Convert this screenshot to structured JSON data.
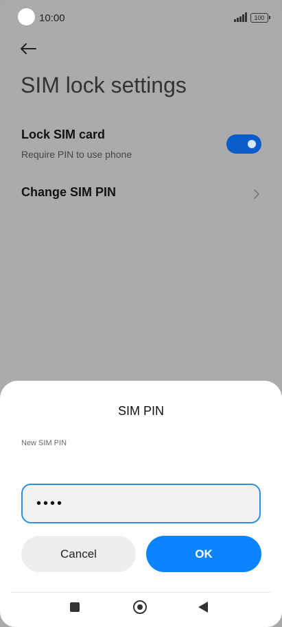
{
  "status_bar": {
    "time": "10:00",
    "battery": "100"
  },
  "page": {
    "title": "SIM lock settings"
  },
  "settings": {
    "lock_sim": {
      "title": "Lock SIM card",
      "subtitle": "Require PIN to use phone",
      "enabled": true
    },
    "change_pin": {
      "title": "Change SIM PIN"
    }
  },
  "dialog": {
    "title": "SIM PIN",
    "field_label": "New SIM PIN",
    "pin_masked": "••••",
    "cancel_label": "Cancel",
    "ok_label": "OK"
  },
  "colors": {
    "accent": "#0d84ff",
    "toggle_on": "#0a5cc8",
    "input_border": "#2a8de6"
  },
  "icons": [
    "back-arrow-icon",
    "chevron-right-icon",
    "signal-icon",
    "battery-icon",
    "recents-icon",
    "home-icon",
    "nav-back-icon"
  ]
}
